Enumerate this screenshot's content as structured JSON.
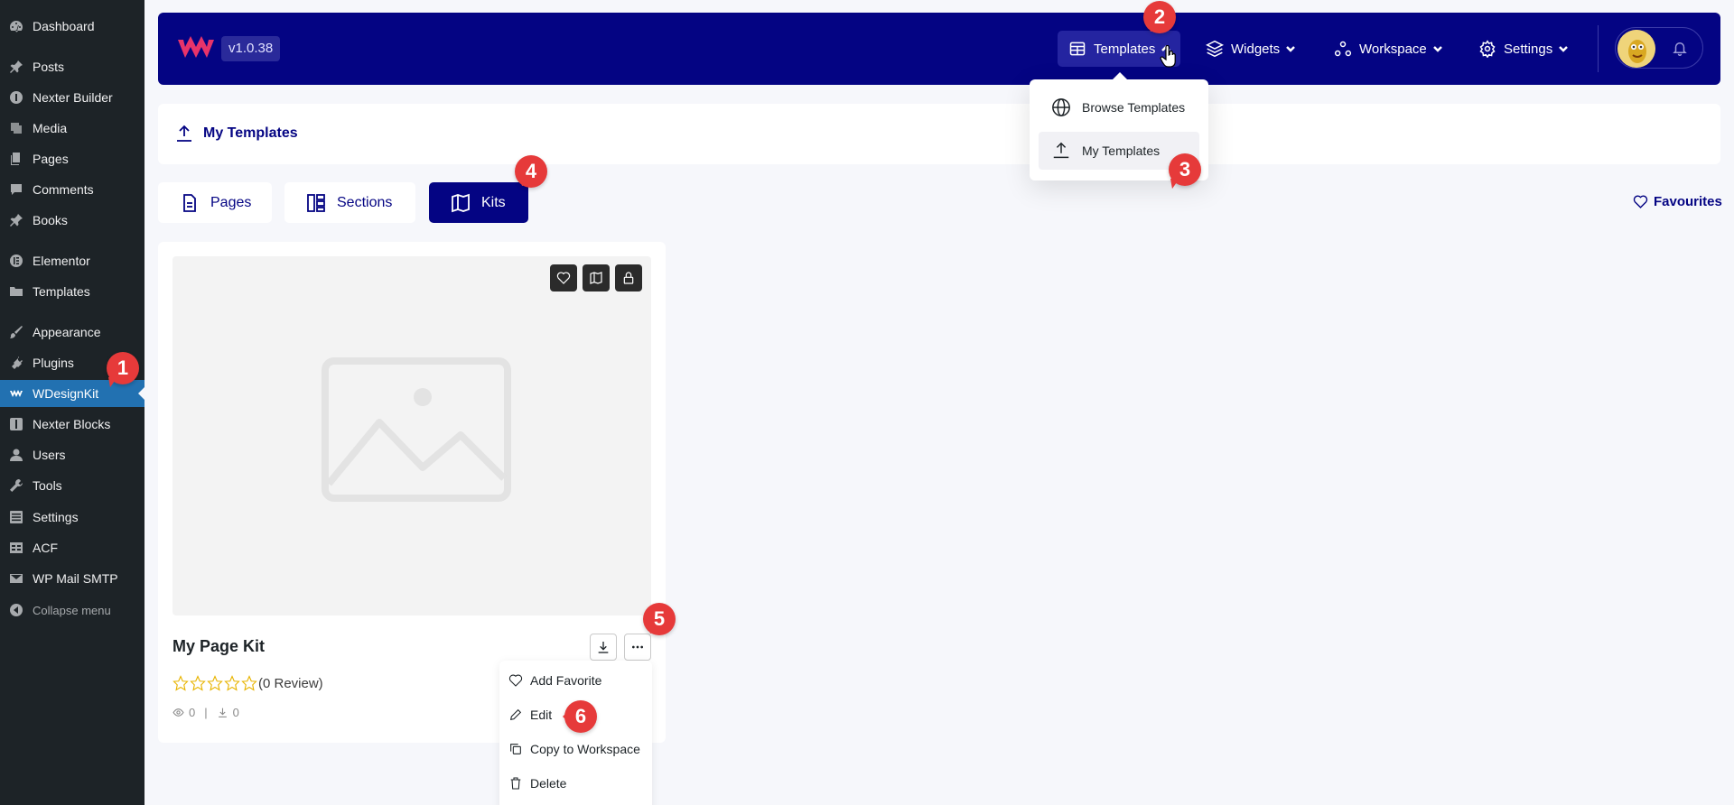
{
  "sidebar": {
    "items": [
      {
        "label": "Dashboard",
        "icon": "dashboard-icon"
      },
      {
        "label": "Posts",
        "icon": "pin-icon"
      },
      {
        "label": "Nexter Builder",
        "icon": "info-icon"
      },
      {
        "label": "Media",
        "icon": "media-icon"
      },
      {
        "label": "Pages",
        "icon": "pages-icon"
      },
      {
        "label": "Comments",
        "icon": "comment-icon"
      },
      {
        "label": "Books",
        "icon": "pin-icon"
      },
      {
        "label": "Elementor",
        "icon": "elementor-icon"
      },
      {
        "label": "Templates",
        "icon": "folder-icon"
      },
      {
        "label": "Appearance",
        "icon": "brush-icon"
      },
      {
        "label": "Plugins",
        "icon": "plug-icon"
      },
      {
        "label": "WDesignKit",
        "icon": "wdesignkit-icon",
        "active": true
      },
      {
        "label": "Nexter Blocks",
        "icon": "blocks-icon"
      },
      {
        "label": "Users",
        "icon": "user-icon"
      },
      {
        "label": "Tools",
        "icon": "wrench-icon"
      },
      {
        "label": "Settings",
        "icon": "settings-icon"
      },
      {
        "label": "ACF",
        "icon": "table-icon"
      },
      {
        "label": "WP Mail SMTP",
        "icon": "mail-icon"
      },
      {
        "label": "Collapse menu",
        "icon": "collapse-icon"
      }
    ]
  },
  "topbar": {
    "version": "v1.0.38",
    "nav": {
      "templates": "Templates",
      "widgets": "Widgets",
      "workspace": "Workspace",
      "settings": "Settings"
    }
  },
  "dropdown": {
    "items": [
      {
        "label": "Browse Templates",
        "icon": "globe-icon"
      },
      {
        "label": "My Templates",
        "icon": "upload-icon"
      }
    ]
  },
  "heading": {
    "title": "My Templates"
  },
  "tabs": {
    "pages": "Pages",
    "sections": "Sections",
    "kits": "Kits",
    "active": "Kits"
  },
  "favourites_label": "Favourites",
  "card": {
    "name": "My Page Kit",
    "rating": 0,
    "reviews_text": "(0 Review)",
    "views": "0",
    "downloads": "0"
  },
  "action_menu": {
    "items": [
      {
        "label": "Add Favorite",
        "icon": "heart-icon"
      },
      {
        "label": "Edit",
        "icon": "pencil-icon"
      },
      {
        "label": "Copy to Workspace",
        "icon": "copy-icon"
      },
      {
        "label": "Delete",
        "icon": "trash-icon"
      }
    ]
  },
  "markers": [
    "1",
    "2",
    "3",
    "4",
    "5",
    "6"
  ],
  "colors": {
    "brand_navy": "#040483",
    "wp_sidebar": "#1d2327",
    "wp_active": "#2271b1",
    "marker_red": "#e63a3a",
    "star": "#e8b400",
    "logo_pink": "#e8336a"
  }
}
